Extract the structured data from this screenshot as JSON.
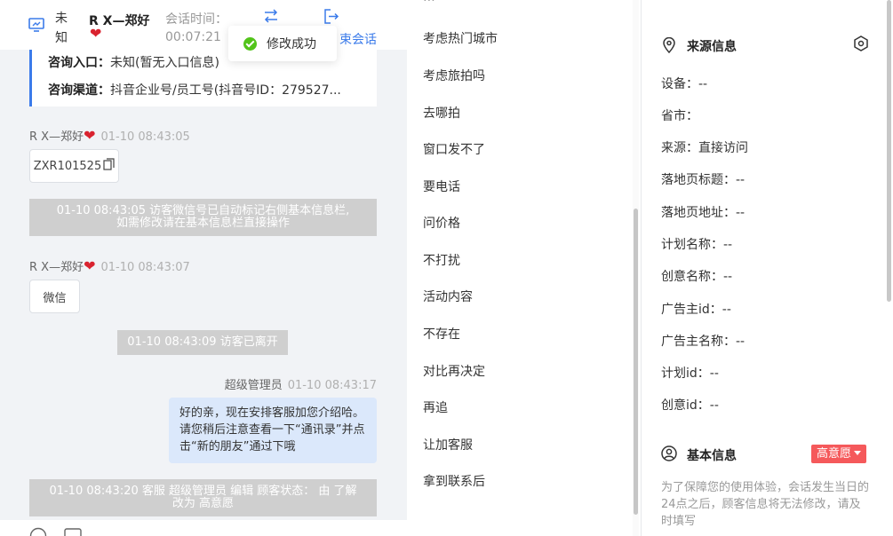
{
  "chat": {
    "header": {
      "visitor_status": "未知",
      "visitor_name": "R X—郑好",
      "session_label": "会话时间：",
      "session_time": "00:07:21",
      "end_session": "束会话"
    },
    "toast": "修改成功",
    "consult": {
      "entry_label": "咨询入口：",
      "entry_value": "未知(暂无入口信息)",
      "channel_label": "咨询渠道：",
      "channel_value": "抖音企业号/员工号(抖音号ID：279527..."
    },
    "messages": [
      {
        "sender": "R X—郑好",
        "time": "01-10 08:43:05",
        "content": "ZXR101525"
      },
      {
        "note": "01-10 08:43:05 访客微信号已自动标记右侧基本信息栏,",
        "note2": "如需修改请在基本信息栏直接操作"
      },
      {
        "sender": "R X—郑好",
        "time": "01-10 08:43:07",
        "content": "微信"
      },
      {
        "note": "01-10 08:43:09 访客已离开"
      },
      {
        "sender": "超级管理员",
        "time": "01-10 08:43:17",
        "content": "好的亲，现在安排客服加您介绍哈。请您稍后注意查看一下“通讯录”并点击“新的朋友”通过下哦"
      },
      {
        "note": "01-10 08:43:20 客服 超级管理员 编辑 顾客状态： 由 了解",
        "note2": "改为 高意愿"
      }
    ]
  },
  "quick_replies": {
    "items": [
      "考虑热门城市",
      "考虑旅拍吗",
      "去哪拍",
      "窗口发不了",
      "要电话",
      "问价格",
      "不打扰",
      "活动内容",
      "不存在",
      "对比再决定",
      "再追",
      "让加客服",
      "拿到联系后"
    ]
  },
  "info": {
    "source": {
      "title": "来源信息",
      "rows": [
        "设备：--",
        "省市：",
        "来源：直接访问",
        "落地页标题：--",
        "落地页地址：--",
        "计划名称：--",
        "创意名称：--",
        "广告主id：--",
        "广告主名称：--",
        "计划id：--",
        "创意id：--"
      ]
    },
    "basic": {
      "title": "基本信息",
      "intent": "高意愿",
      "note": "为了保障您的使用体验，会话发生当日的24点之后，顾客信息将无法修改，请及时填写"
    },
    "colors": {
      "accent": "#3b7bea",
      "badge": "#f5595b",
      "heart": "#d9232f",
      "success": "#52c41a"
    }
  }
}
